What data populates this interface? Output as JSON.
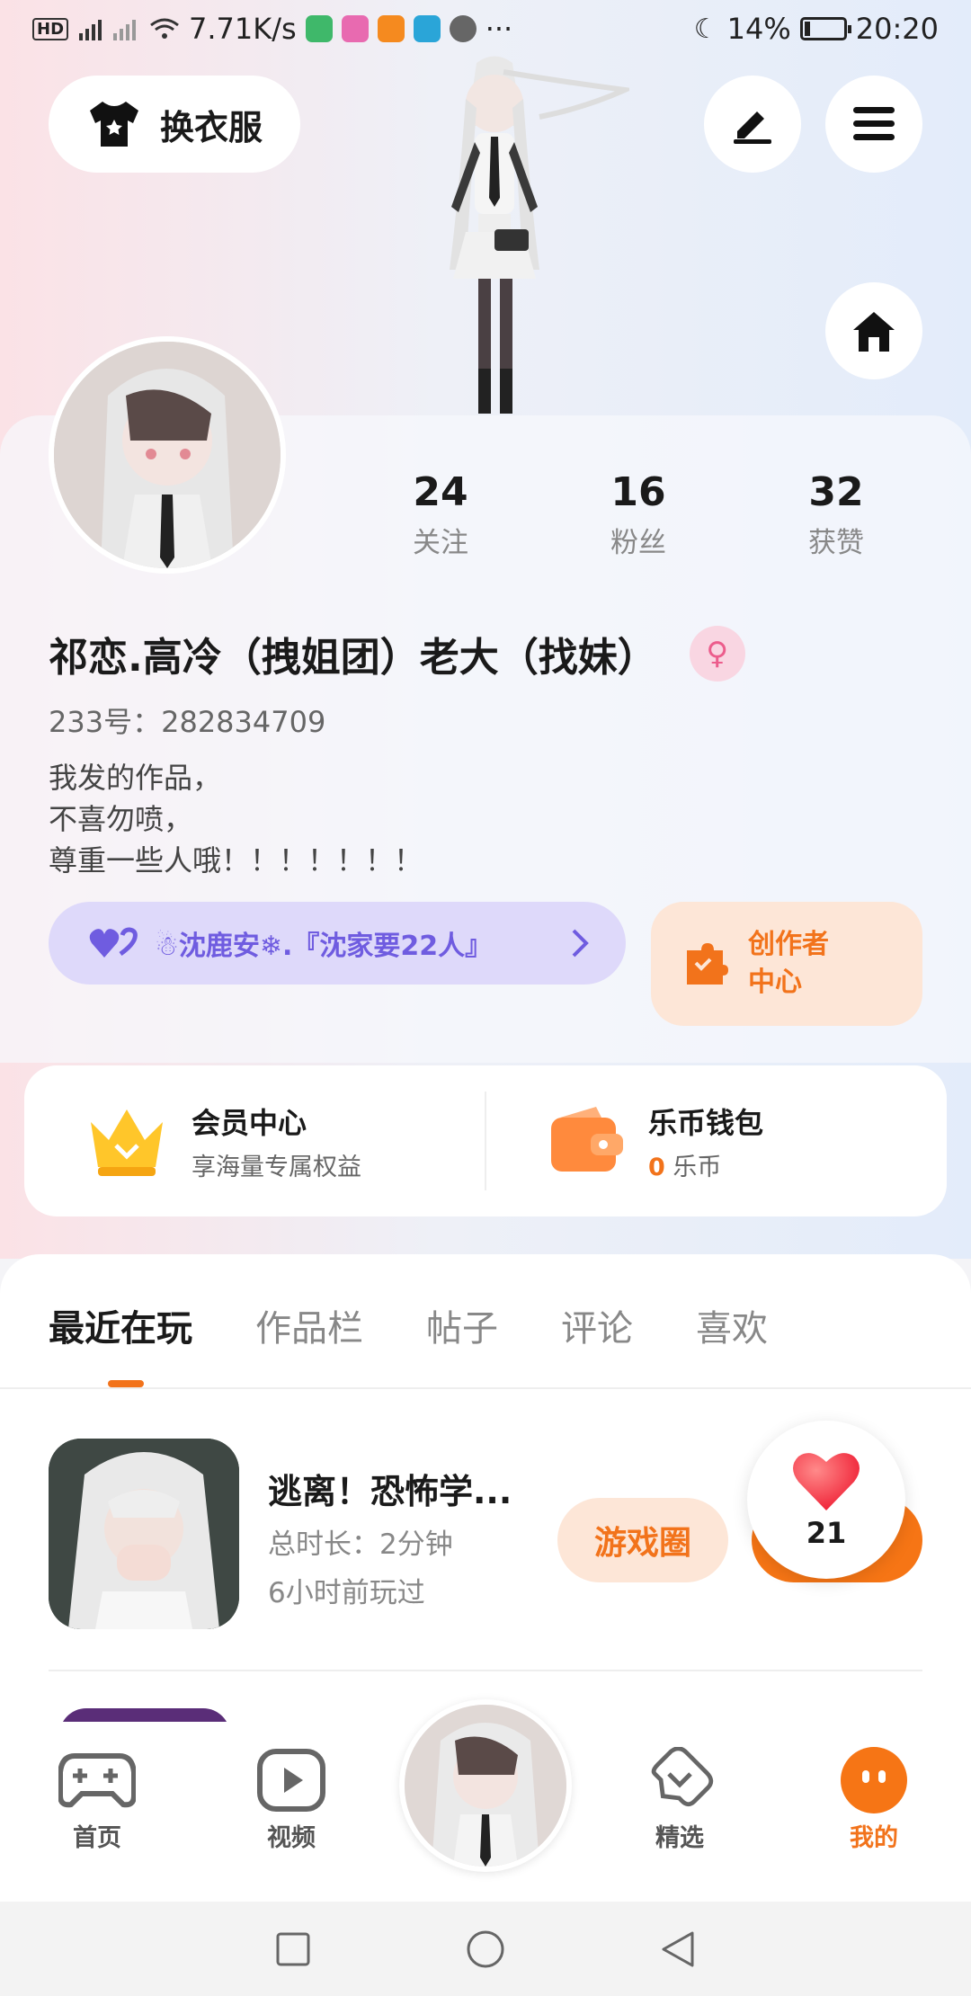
{
  "status_bar": {
    "network_badge": "HD",
    "net_speed": "7.71K/s",
    "more": "···",
    "battery": "14%",
    "battery_level": 0.14,
    "time": "20:20"
  },
  "header": {
    "dress_up_label": "换衣服",
    "icons": [
      "shirt-icon",
      "edit-icon",
      "menu-icon",
      "home-icon"
    ]
  },
  "profile": {
    "stats": [
      {
        "value": "24",
        "label": "关注"
      },
      {
        "value": "16",
        "label": "粉丝"
      },
      {
        "value": "32",
        "label": "获赞"
      }
    ],
    "nickname": "祁恋.高冷（拽姐团）老大（找妹）",
    "gender_symbol": "♀",
    "uid_label": "233号：",
    "uid": "282834709",
    "bio": [
      "我发的作品，",
      "不喜勿喷，",
      "尊重一些人哦！！！！！！！"
    ],
    "fan_group": "☃沈鹿安❄.『沈家要22人』",
    "creator_line1": "创作者",
    "creator_line2": "中心"
  },
  "services": {
    "member_title": "会员中心",
    "member_sub": "享海量专属权益",
    "wallet_title": "乐币钱包",
    "wallet_amount": "0",
    "wallet_unit": "乐币"
  },
  "tabs": [
    "最近在玩",
    "作品栏",
    "帖子",
    "评论",
    "喜欢"
  ],
  "recent_game": {
    "title": "逃离！恐怖学...",
    "duration": "总时长：2分钟",
    "last_played": "6小时前玩过",
    "circle_button": "游戏圈",
    "likes": "21"
  },
  "bottom_nav": [
    {
      "label": "首页",
      "icon": "gamepad-icon"
    },
    {
      "label": "视频",
      "icon": "video-icon"
    },
    {
      "label": "精选",
      "icon": "heart-chat-icon"
    },
    {
      "label": "我的",
      "icon": "me-icon"
    }
  ],
  "colors": {
    "accent": "#f2731b",
    "fan_purple": "#6f5ce0"
  }
}
